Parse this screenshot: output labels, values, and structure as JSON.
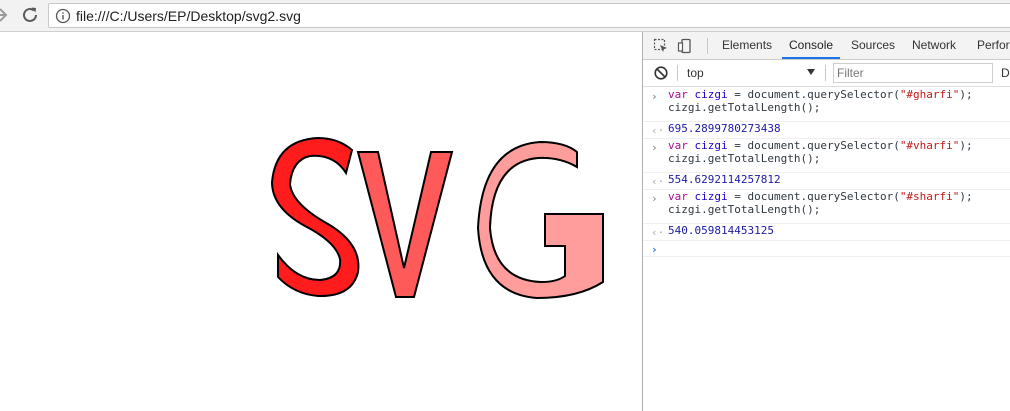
{
  "browser": {
    "url": "file:///C:/Users/EP/Desktop/svg2.svg"
  },
  "page": {
    "letters": [
      {
        "char": "S",
        "fill": "#ff1c1c"
      },
      {
        "char": "V",
        "fill": "#ff5a5a"
      },
      {
        "char": "G",
        "fill": "#ff9d9d"
      }
    ]
  },
  "devtools": {
    "tabs": [
      "Elements",
      "Console",
      "Sources",
      "Network",
      "Perfor"
    ],
    "active_tab": "Console",
    "context": "top",
    "filter_placeholder": "Filter",
    "levels_label": "D",
    "console": [
      {
        "keyword": "var",
        "variable": "cizgi",
        "pre": " = document.querySelector(",
        "selector": "\"#gharfi\"",
        "post": ");",
        "line2": "cizgi.getTotalLength();",
        "result": "695.2899780273438"
      },
      {
        "keyword": "var",
        "variable": "cizgi",
        "pre": " = document.querySelector(",
        "selector": "\"#vharfi\"",
        "post": ");",
        "line2": "cizgi.getTotalLength();",
        "result": "554.6292114257812"
      },
      {
        "keyword": "var",
        "variable": "cizgi",
        "pre": " = document.querySelector(",
        "selector": "\"#sharfi\"",
        "post": ");",
        "line2": "cizgi.getTotalLength();",
        "result": "540.059814453125"
      }
    ]
  }
}
